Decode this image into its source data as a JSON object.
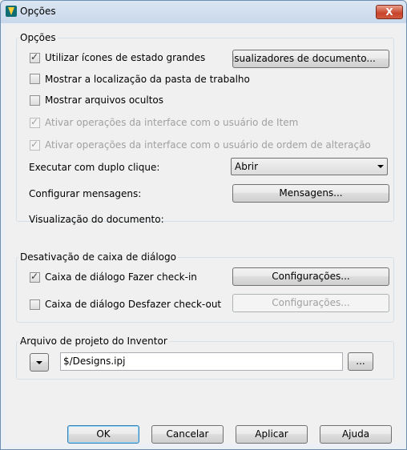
{
  "window": {
    "title": "Opções",
    "close_label": "X"
  },
  "opcoes": {
    "legend": "Opções",
    "checkboxes": [
      {
        "label": "Utilizar ícones de estado grandes",
        "checked": true,
        "disabled": false
      },
      {
        "label": "Mostrar a localização da pasta de trabalho",
        "checked": false,
        "disabled": false
      },
      {
        "label": "Mostrar arquivos ocultos",
        "checked": false,
        "disabled": false
      },
      {
        "label": "Ativar operações da interface com o usuário de Item",
        "checked": true,
        "disabled": true
      },
      {
        "label": "Ativar operações da interface com o usuário de ordem de alteração",
        "checked": true,
        "disabled": true
      }
    ],
    "viewers_button": "Visualizadores de documento...",
    "double_click_label": "Executar com duplo clique:",
    "double_click_value": "Abrir",
    "messages_label": "Configurar mensagens:",
    "messages_button": "Mensagens...",
    "doc_view_label": "Visualização do documento:"
  },
  "dialog_disable": {
    "legend": "Desativação de caixa de diálogo",
    "checkin_label": "Caixa de diálogo Fazer check-in",
    "checkin_checked": true,
    "checkin_button": "Configurações...",
    "undo_checkout_label": "Caixa de diálogo Desfazer check-out",
    "undo_checkout_checked": false,
    "undo_checkout_button": "Configurações..."
  },
  "project": {
    "legend": "Arquivo de projeto do Inventor",
    "path_value": "$/Designs.ipj",
    "browse_button": "..."
  },
  "footer": {
    "ok": "OK",
    "cancel": "Cancelar",
    "apply": "Aplicar",
    "help": "Ajuda"
  }
}
